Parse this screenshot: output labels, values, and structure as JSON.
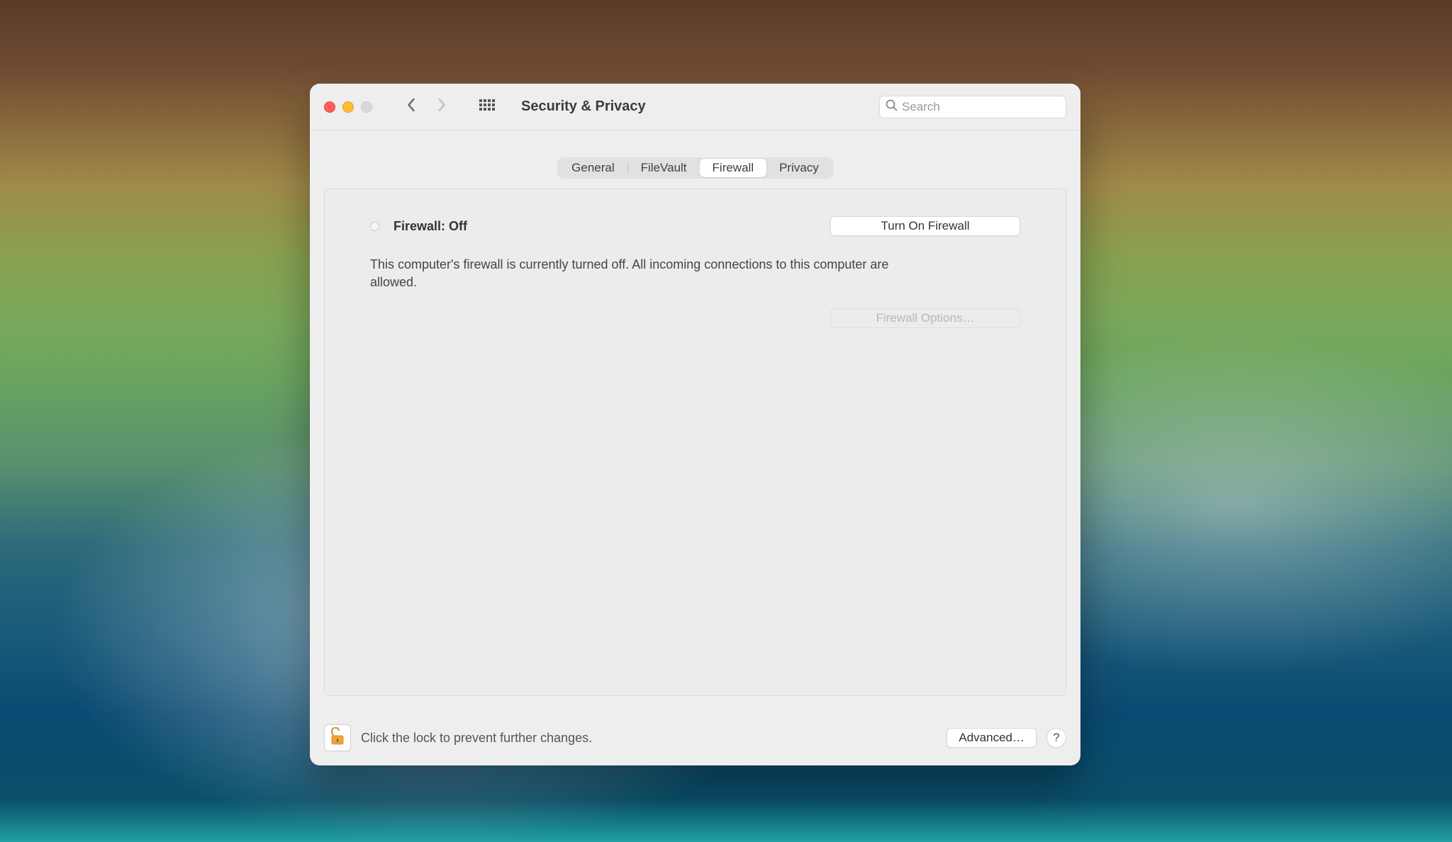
{
  "window": {
    "title": "Security & Privacy"
  },
  "search": {
    "placeholder": "Search",
    "value": ""
  },
  "tabs": {
    "items": [
      {
        "label": "General"
      },
      {
        "label": "FileVault"
      },
      {
        "label": "Firewall"
      },
      {
        "label": "Privacy"
      }
    ],
    "active": 2
  },
  "firewall": {
    "status_label": "Firewall: Off",
    "turn_on_label": "Turn On Firewall",
    "description": "This computer's firewall is currently turned off. All incoming connections to this computer are allowed.",
    "options_label": "Firewall Options…"
  },
  "footer": {
    "lock_text": "Click the lock to prevent further changes.",
    "advanced_label": "Advanced…",
    "help_label": "?"
  }
}
